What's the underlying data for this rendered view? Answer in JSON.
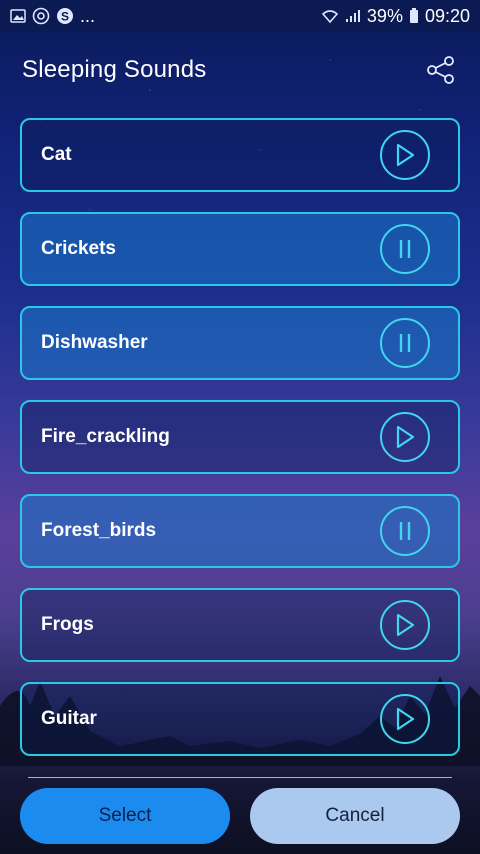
{
  "status_bar": {
    "left_icons": [
      "image-icon",
      "skype-like-icon",
      "skype-icon"
    ],
    "ellipsis": "...",
    "battery_percent": "39%",
    "time": "09:20"
  },
  "app": {
    "title": "Sleeping Sounds",
    "share_icon": "share-icon"
  },
  "sounds": [
    {
      "label": "Cat",
      "state": "play"
    },
    {
      "label": "Crickets",
      "state": "pause"
    },
    {
      "label": "Dishwasher",
      "state": "pause"
    },
    {
      "label": "Fire_crackling",
      "state": "play"
    },
    {
      "label": "Forest_birds",
      "state": "pause"
    },
    {
      "label": "Frogs",
      "state": "play"
    },
    {
      "label": "Guitar",
      "state": "play"
    }
  ],
  "actions": {
    "select_label": "Select",
    "cancel_label": "Cancel"
  },
  "colors": {
    "accent": "#29c9e6",
    "select_button": "#1c8bf0",
    "cancel_button": "#abc8ee"
  }
}
